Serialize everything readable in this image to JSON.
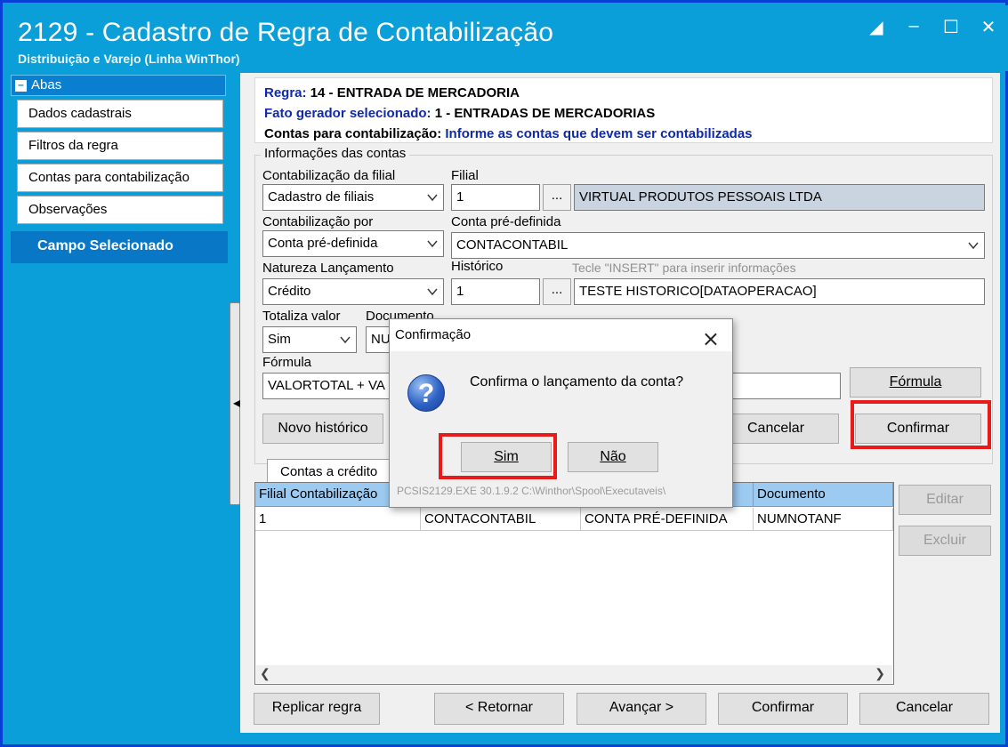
{
  "window": {
    "title": "2129 - Cadastro de Regra de Contabilização",
    "subtitle": "Distribuição e Varejo (Linha WinThor)"
  },
  "sidebar": {
    "header": "Abas",
    "items": [
      {
        "label": "Dados cadastrais"
      },
      {
        "label": "Filtros da regra"
      },
      {
        "label": "Contas para contabilização"
      },
      {
        "label": "Observações"
      }
    ],
    "selected_section": "Campo Selecionado"
  },
  "rule": {
    "regra_label": "Regra:",
    "regra_value": "14 - ENTRADA DE MERCADORIA",
    "fato_label": "Fato gerador selecionado:",
    "fato_value": "1 - ENTRADAS DE MERCADORIAS",
    "contas_label": "Contas para contabilização:",
    "contas_value": "Informe as contas que devem ser contabilizadas"
  },
  "form": {
    "group_title": "Informações das contas",
    "contab_filial_label": "Contabilização da filial",
    "contab_filial_value": "Cadastro de filiais",
    "filial_label": "Filial",
    "filial_code": "1",
    "filial_name": "VIRTUAL PRODUTOS PESSOAIS LTDA",
    "contab_por_label": "Contabilização por",
    "contab_por_value": "Conta pré-definida",
    "conta_pre_label": "Conta pré-definida",
    "conta_pre_value": "CONTACONTABIL",
    "natureza_label": "Natureza Lançamento",
    "natureza_value": "Crédito",
    "historico_label": "Histórico",
    "historico_hint": "Tecle  \"INSERT\" para inserir informações",
    "historico_code": "1",
    "historico_text": "TESTE HISTORICO[DATAOPERACAO]",
    "totaliza_label": "Totaliza valor",
    "totaliza_value": "Sim",
    "documento_label": "Documento",
    "documento_value": "NU",
    "formula_label": "Fórmula",
    "formula_value": "VALORTOTAL + VA",
    "dots": "..."
  },
  "buttons": {
    "formula": "Fórmula",
    "novo_historico": "Novo histórico",
    "cancelar": "Cancelar",
    "confirmar": "Confirmar",
    "editar": "Editar",
    "excluir": "Excluir",
    "replicar": "Replicar regra",
    "retornar": "< Retornar",
    "avancar": "Avançar >",
    "confirmar_bottom": "Confirmar",
    "cancelar_bottom": "Cancelar"
  },
  "grid": {
    "tab_label": "Contas a crédito",
    "columns": [
      "Filial Contabilização",
      "",
      "",
      "Documento"
    ],
    "rows": [
      [
        "1",
        "CONTACONTABIL",
        "CONTA PRÉ-DEFINIDA",
        "NUMNOTANF"
      ]
    ]
  },
  "dialog": {
    "title": "Confirmação",
    "message": "Confirma o lançamento da conta?",
    "yes": "Sim",
    "no": "Não",
    "status": "PCSIS2129.EXE 30.1.9.2 C:\\Winthor\\Spool\\Executaveis\\"
  },
  "colors": {
    "window_accent": "#0a9fd8",
    "highlight_red": "#e81b1b",
    "grid_header": "#9ccaf0",
    "label_blue": "#102aa8"
  }
}
